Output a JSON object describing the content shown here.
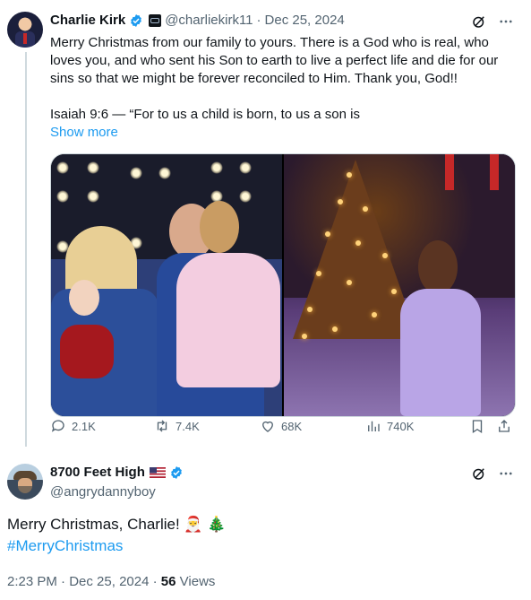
{
  "tweet": {
    "author_name": "Charlie Kirk",
    "handle": "@charliekirk11",
    "sep": "·",
    "date": "Dec 25, 2024",
    "text_lines": [
      "Merry Christmas from our family to yours. There is a God who is real, who",
      "loves you, and who sent his Son to earth to live a perfect life and die for our",
      "sins so that we might be forever reconciled to Him. Thank you, God!!",
      "Isaiah 9:6 — “For to us a child is born, to us a son is"
    ],
    "show_more": "Show more",
    "stats": {
      "replies": "2.1K",
      "reposts": "7.4K",
      "likes": "68K",
      "views": "740K"
    }
  },
  "reply": {
    "author_name": "8700 Feet High",
    "handle": "@angrydannyboy",
    "text": "Merry Christmas, Charlie! 🎅 🎄",
    "hashtag": "#MerryChristmas",
    "time": "2:23 PM",
    "sep": "·",
    "date": "Dec 25, 2024",
    "sep2": "·",
    "views_count": "56",
    "views_label": "Views"
  },
  "colors": {
    "accent": "#1d9bf0",
    "text": "#0f1419",
    "muted": "#536471",
    "line": "#cfd9de"
  },
  "icons": [
    "verified-badge-icon",
    "grok-icon",
    "more-icon",
    "reply-icon",
    "repost-icon",
    "like-icon",
    "views-icon",
    "bookmark-icon",
    "share-icon"
  ]
}
